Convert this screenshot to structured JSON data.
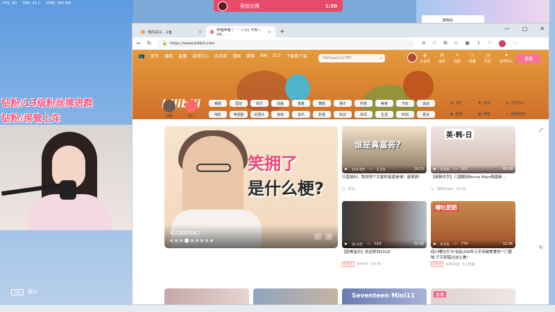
{
  "stats": {
    "fps": "FPS: 60",
    "temp": "TMP: 41 C",
    "vram": "VRM: 393 MB"
  },
  "match": {
    "title": "竞技比赛",
    "timer": "1:30"
  },
  "overlay": {
    "line1": "钻粉/13级粉丝牌进群",
    "line2": "钻粉/房管上车"
  },
  "cam": {
    "tag": "回车",
    "label": "聊天"
  },
  "bing_ad": {
    "text": "BING"
  },
  "browser": {
    "tabs": [
      {
        "label": "我的关注 - 斗鱼"
      },
      {
        "label": "哔哩哔哩 (゜-゜)つロ 干杯~-bili..."
      }
    ],
    "new_tab": "+",
    "url": "https://www.bilibili.com"
  },
  "bili": {
    "nav": [
      "首页",
      "番剧",
      "直播",
      "游戏中心",
      "会员购",
      "漫画",
      "赛事",
      "BW",
      "S13",
      "下载客户端"
    ],
    "search_placeholder": "DiVfoxed11s7MT",
    "right": [
      "大会员",
      "消息",
      "动态",
      "收藏",
      "历史",
      "创作中心"
    ],
    "right_badge": "48",
    "upload": "投稿",
    "logo": "bilibili"
  },
  "channels": {
    "icons": [
      "动态",
      "热门"
    ],
    "chips_row1": [
      "番剧",
      "国创",
      "综艺",
      "动画",
      "鬼畜",
      "舞蹈",
      "娱乐",
      "科技",
      "美食",
      "汽车",
      "运动"
    ],
    "chips_row2": [
      "电影",
      "电视剧",
      "纪录片",
      "游戏",
      "音乐",
      "影视",
      "知识",
      "资讯",
      "生活",
      "时尚",
      "更多"
    ],
    "links": [
      "专栏",
      "直播",
      "活动",
      "课堂",
      "社区中心",
      "新歌热榜"
    ]
  },
  "carousel": {
    "big_text_1": "笑拥了",
    "big_text_2": "是什么梗?",
    "caption": "看完直接笑拥了",
    "dots": 9,
    "active_dot": 4
  },
  "cards": [
    {
      "overtext": "谁是真富哥?",
      "views": "119.4万",
      "danmaku": "2.1万",
      "duration": "29:23",
      "title": "只直接问，我觉得个大家的富豪是谁！富哥真！",
      "up": "凉天",
      "badge": ""
    },
    {
      "overtext": "英·韩·日",
      "views": "4.5万",
      "danmaku": "162",
      "duration": "06:29",
      "title": "【英韩中字】三国解说Bruno Mars韩国新...",
      "up": "凉的5owe",
      "date": "10-30",
      "badge": ""
    },
    {
      "overtext": "",
      "views": "31.5万",
      "danmaku": "510",
      "duration": "02:56",
      "title": "【欧美音乐】欢迎来到2018",
      "up": "Omik7",
      "date": "10-30",
      "badge": "已关注"
    },
    {
      "overtext": "嘈吐肥肥",
      "views": "6.5万",
      "danmaku": "779",
      "duration": "12:34",
      "title": "四川嘈吐打卡!如此200年几乎传统美食的一门家味,千万别错过这么美!",
      "up": "半肝半的",
      "date": "5小时前",
      "badge": "已关注"
    }
  ],
  "bottom_cards": [
    {
      "label": ""
    },
    {
      "label": ""
    },
    {
      "label": "Seventeen Mini11"
    },
    {
      "label": "直播"
    }
  ]
}
